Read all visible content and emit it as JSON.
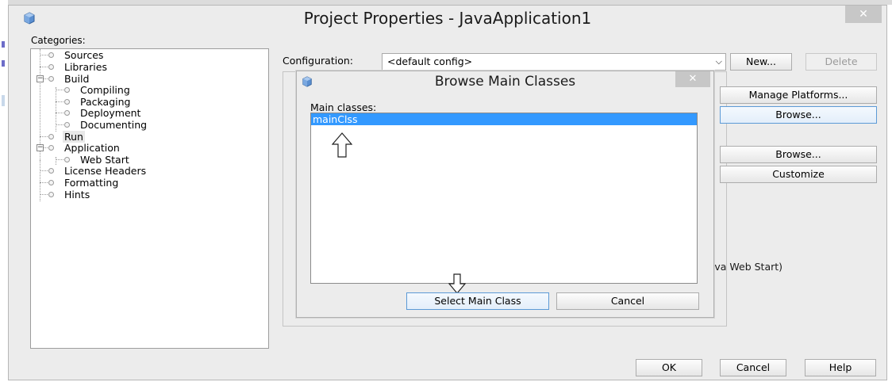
{
  "window": {
    "title": "Project Properties - JavaApplication1",
    "close_glyph": "✕"
  },
  "categories": {
    "label": "Categories:",
    "items": [
      {
        "label": "Sources"
      },
      {
        "label": "Libraries"
      },
      {
        "label": "Build"
      },
      {
        "label": "Compiling"
      },
      {
        "label": "Packaging"
      },
      {
        "label": "Deployment"
      },
      {
        "label": "Documenting"
      },
      {
        "label": "Run"
      },
      {
        "label": "Application"
      },
      {
        "label": "Web Start"
      },
      {
        "label": "License Headers"
      },
      {
        "label": "Formatting"
      },
      {
        "label": "Hints"
      }
    ]
  },
  "configuration": {
    "label": "Configuration:",
    "value": "<default config>",
    "new_label": "New...",
    "delete_label": "Delete"
  },
  "right_buttons": {
    "manage_platforms": "Manage Platforms...",
    "browse_1": "Browse...",
    "browse_2": "Browse...",
    "customize": "Customize"
  },
  "partial_text": "Java Web Start)",
  "browse_dialog": {
    "title": "Browse Main Classes",
    "close_glyph": "✕",
    "main_classes_label": "Main classes:",
    "classes": [
      "mainClss"
    ],
    "select_label": "Select Main Class",
    "cancel_label": "Cancel"
  },
  "footer": {
    "ok_label": "OK",
    "cancel_label": "Cancel",
    "help_label": "Help"
  },
  "icons": {
    "app": "netbeans-cube-icon",
    "tree_node": "bullet-icon"
  },
  "colors": {
    "selection": "#3399ff",
    "dialog_bg": "#ececec",
    "close_button": "#c7c7c7"
  }
}
